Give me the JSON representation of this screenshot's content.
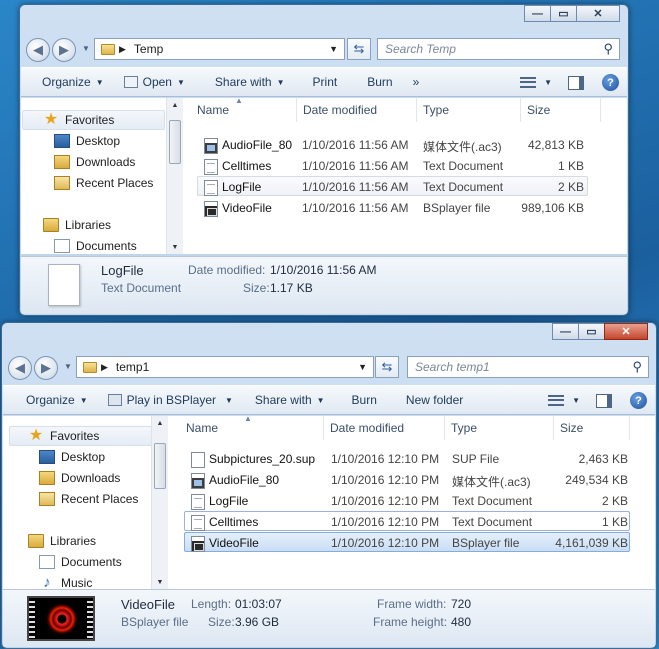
{
  "window1": {
    "address": {
      "path": "Temp"
    },
    "search_placeholder": "Search Temp",
    "toolbar": [
      "Organize",
      "Open",
      "Share with",
      "Print",
      "Burn"
    ],
    "toolbar_overflow": "»",
    "nav": {
      "favorites": "Favorites",
      "items": [
        "Desktop",
        "Downloads",
        "Recent Places"
      ],
      "libraries": "Libraries",
      "lib_items": [
        "Documents"
      ]
    },
    "columns": [
      "Name",
      "Date modified",
      "Type",
      "Size"
    ],
    "files": [
      {
        "name": "AudioFile_80",
        "date": "1/10/2016 11:56 AM",
        "type": "媒体文件(.ac3)",
        "size": "42,813 KB",
        "icon": "media-file-icon"
      },
      {
        "name": "Celltimes",
        "date": "1/10/2016 11:56 AM",
        "type": "Text Document",
        "size": "1 KB",
        "icon": "text-document-icon"
      },
      {
        "name": "LogFile",
        "date": "1/10/2016 11:56 AM",
        "type": "Text Document",
        "size": "2 KB",
        "icon": "text-document-icon"
      },
      {
        "name": "VideoFile",
        "date": "1/10/2016 11:56 AM",
        "type": "BSplayer file",
        "size": "989,106 KB",
        "icon": "bsplayer-file-icon"
      }
    ],
    "details": {
      "name": "LogFile",
      "type": "Text Document",
      "date_label": "Date modified:",
      "date_value": "1/10/2016 11:56 AM",
      "size_label": "Size:",
      "size_value": "1.17 KB"
    }
  },
  "window2": {
    "address": {
      "path": "temp1"
    },
    "search_placeholder": "Search temp1",
    "toolbar": [
      "Organize",
      "Play in BSPlayer",
      "Share with",
      "Burn",
      "New folder"
    ],
    "nav": {
      "favorites": "Favorites",
      "items": [
        "Desktop",
        "Downloads",
        "Recent Places"
      ],
      "libraries": "Libraries",
      "lib_items": [
        "Documents",
        "Music"
      ]
    },
    "columns": [
      "Name",
      "Date modified",
      "Type",
      "Size"
    ],
    "files": [
      {
        "name": "Subpictures_20.sup",
        "date": "1/10/2016 12:10 PM",
        "type": "SUP File",
        "size": "2,463 KB",
        "icon": "blank-file-icon"
      },
      {
        "name": "AudioFile_80",
        "date": "1/10/2016 12:10 PM",
        "type": "媒体文件(.ac3)",
        "size": "249,534 KB",
        "icon": "media-file-icon"
      },
      {
        "name": "LogFile",
        "date": "1/10/2016 12:10 PM",
        "type": "Text Document",
        "size": "2 KB",
        "icon": "text-document-icon"
      },
      {
        "name": "Celltimes",
        "date": "1/10/2016 12:10 PM",
        "type": "Text Document",
        "size": "1 KB",
        "icon": "text-document-icon"
      },
      {
        "name": "VideoFile",
        "date": "1/10/2016 12:10 PM",
        "type": "BSplayer file",
        "size": "4,161,039 KB",
        "icon": "bsplayer-file-icon"
      }
    ],
    "details": {
      "name": "VideoFile",
      "type": "BSplayer file",
      "length_label": "Length:",
      "length_value": "01:03:07",
      "size_label": "Size:",
      "size_value": "3.96 GB",
      "fw_label": "Frame width:",
      "fw_value": "720",
      "fh_label": "Frame height:",
      "fh_value": "480"
    }
  },
  "colors": {
    "accent": "#3399ff",
    "selection": "#c9ddf5",
    "window_frame": "#bcd4ec"
  }
}
